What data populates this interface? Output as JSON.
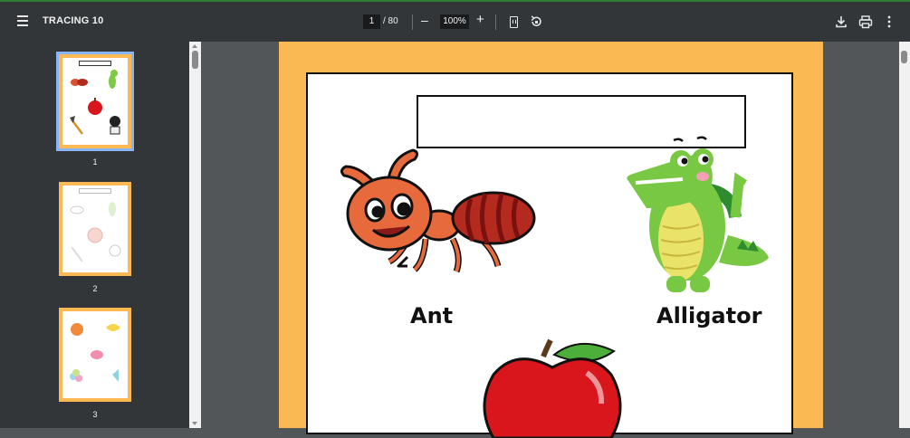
{
  "toolbar": {
    "title": "TRACING 10",
    "current_page": "1",
    "total_pages": "/ 80",
    "zoom_minus": "–",
    "zoom": "100%",
    "zoom_plus": "+"
  },
  "thumbnails": [
    {
      "number": "1",
      "selected": true
    },
    {
      "number": "2",
      "selected": false
    },
    {
      "number": "3",
      "selected": false
    }
  ],
  "page": {
    "words": [
      "Ant",
      "Alligator"
    ],
    "images": [
      "ant-illustration",
      "alligator-illustration",
      "apple-illustration"
    ]
  },
  "colors": {
    "toolbar": "#323639",
    "viewer_bg": "#525659",
    "page_border": "#fbb954",
    "selection": "#8ab4f8"
  }
}
